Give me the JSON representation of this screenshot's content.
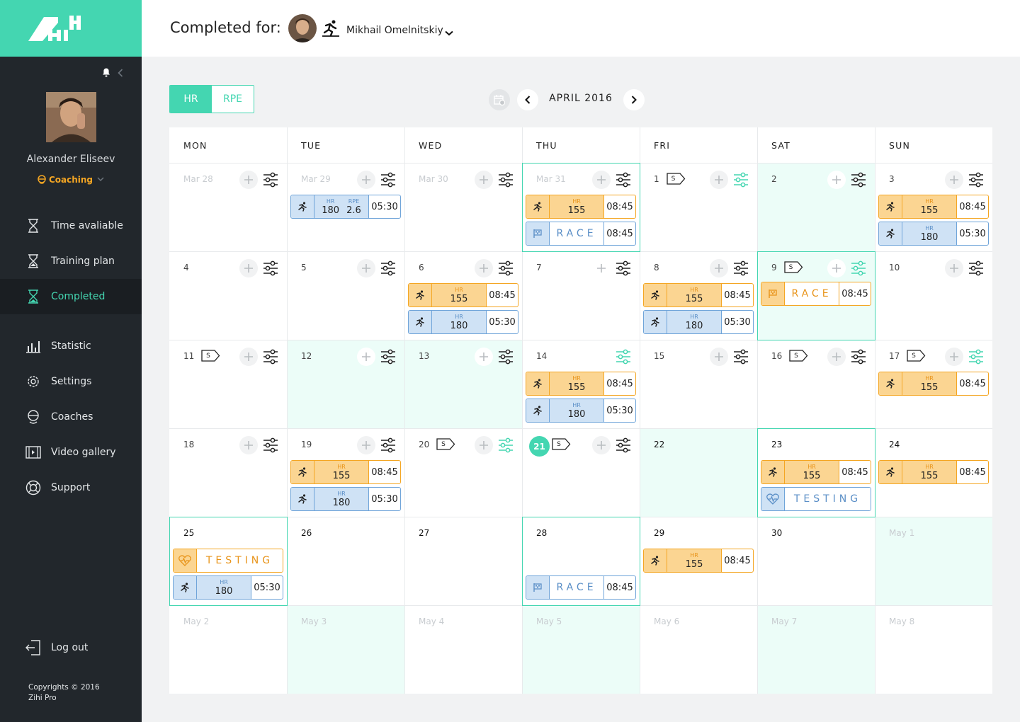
{
  "sidebar": {
    "user_name": "Alexander Eliseev",
    "role_label": "Coaching",
    "nav": [
      {
        "label": "Time avaliable",
        "icon": "hourglass-icon"
      },
      {
        "label": "Training plan",
        "icon": "hourglass-icon"
      },
      {
        "label": "Completed",
        "icon": "hourglass-icon",
        "active": true
      },
      {
        "label": "Statistic",
        "icon": "bar-chart-icon"
      },
      {
        "label": "Settings",
        "icon": "gear-icon"
      },
      {
        "label": "Coaches",
        "icon": "coach-icon"
      },
      {
        "label": "Video gallery",
        "icon": "video-icon"
      },
      {
        "label": "Support",
        "icon": "lifebuoy-icon"
      }
    ],
    "logout_label": "Log out",
    "copyright_line1": "Copyrights © 2016",
    "copyright_line2": "Zihi Pro"
  },
  "header": {
    "title": "Completed for:",
    "athlete_name": "Mikhail Omelnitskiy"
  },
  "toolbar": {
    "toggle": [
      "HR",
      "RPE"
    ],
    "month_label": "APRIL 2016"
  },
  "colors": {
    "accent": "#44d6b1",
    "orange": "#f4a623",
    "blue": "#6fa4d9",
    "sidebar": "#22272c"
  },
  "calendar": {
    "days_of_week": [
      "MON",
      "TUE",
      "WED",
      "THU",
      "FRI",
      "SAT",
      "SUN"
    ],
    "weeks": [
      [
        {
          "label": "Mar 28",
          "out": true,
          "plus": true,
          "settings": "gray"
        },
        {
          "label": "Mar 29",
          "out": true,
          "plus": true,
          "settings": "gray",
          "cards": [
            {
              "color": "blue",
              "kind": "run",
              "metrics": [
                {
                  "l": "HR",
                  "v": "180"
                },
                {
                  "l": "RPE",
                  "v": "2.6"
                }
              ],
              "time": "05:30"
            }
          ]
        },
        {
          "label": "Mar 30",
          "out": true,
          "plus": true,
          "settings": "gray"
        },
        {
          "label": "Mar 31",
          "out": true,
          "plus": true,
          "settings": "gray",
          "selected": true,
          "cards": [
            {
              "color": "orange",
              "kind": "run",
              "metrics": [
                {
                  "l": "HR",
                  "v": "155"
                }
              ],
              "time": "08:45"
            },
            {
              "color": "blue",
              "kind": "race",
              "text": "RACE",
              "time": "08:45"
            }
          ]
        },
        {
          "label": "1",
          "stag": true,
          "plus": true,
          "settings": "green"
        },
        {
          "label": "2",
          "highlight": true,
          "plus": true,
          "plusWhite": true,
          "settings": "gray"
        },
        {
          "label": "3",
          "plus": true,
          "settings": "gray",
          "cards": [
            {
              "color": "orange",
              "kind": "run",
              "metrics": [
                {
                  "l": "HR",
                  "v": "155"
                }
              ],
              "time": "08:45"
            },
            {
              "color": "blue",
              "kind": "run",
              "metrics": [
                {
                  "l": "HR",
                  "v": "180"
                }
              ],
              "time": "05:30"
            }
          ]
        }
      ],
      [
        {
          "label": "4",
          "plus": true,
          "settings": "gray"
        },
        {
          "label": "5",
          "plus": true,
          "settings": "gray"
        },
        {
          "label": "6",
          "plus": true,
          "settings": "gray",
          "cards": [
            {
              "color": "orange",
              "kind": "run",
              "metrics": [
                {
                  "l": "HR",
                  "v": "155"
                }
              ],
              "time": "08:45"
            },
            {
              "color": "blue",
              "kind": "run",
              "metrics": [
                {
                  "l": "HR",
                  "v": "180"
                }
              ],
              "time": "05:30"
            }
          ]
        },
        {
          "label": "7",
          "plus": true,
          "plusBare": true,
          "settings": "gray"
        },
        {
          "label": "8",
          "plus": true,
          "settings": "gray",
          "cards": [
            {
              "color": "orange",
              "kind": "run",
              "metrics": [
                {
                  "l": "HR",
                  "v": "155"
                }
              ],
              "time": "08:45"
            },
            {
              "color": "blue",
              "kind": "run",
              "metrics": [
                {
                  "l": "HR",
                  "v": "180"
                }
              ],
              "time": "05:30"
            }
          ]
        },
        {
          "label": "9",
          "stag": true,
          "plus": true,
          "settings": "green",
          "selected": true,
          "highlight": true,
          "plusWhite": true,
          "cards": [
            {
              "color": "orange",
              "kind": "race",
              "text": "RACE",
              "time": "08:45"
            }
          ]
        },
        {
          "label": "10",
          "plus": true,
          "settings": "gray"
        }
      ],
      [
        {
          "label": "11",
          "stag": true,
          "plus": true,
          "settings": "gray"
        },
        {
          "label": "12",
          "highlight": true,
          "plus": true,
          "plusWhite": true,
          "settings": "gray"
        },
        {
          "label": "13",
          "highlight": true,
          "plus": true,
          "plusWhite": true,
          "settings": "gray"
        },
        {
          "label": "14",
          "settings": "green",
          "cards": [
            {
              "color": "orange",
              "kind": "run",
              "metrics": [
                {
                  "l": "HR",
                  "v": "155"
                }
              ],
              "time": "08:45"
            },
            {
              "color": "blue",
              "kind": "run",
              "metrics": [
                {
                  "l": "HR",
                  "v": "180"
                }
              ],
              "time": "05:30"
            }
          ]
        },
        {
          "label": "15",
          "plus": true,
          "settings": "gray"
        },
        {
          "label": "16",
          "stag": true,
          "plus": true,
          "settings": "gray"
        },
        {
          "label": "17",
          "stag": true,
          "plus": true,
          "settings": "green",
          "cards": [
            {
              "color": "orange",
              "kind": "run",
              "metrics": [
                {
                  "l": "HR",
                  "v": "155"
                }
              ],
              "time": "08:45"
            }
          ]
        }
      ],
      [
        {
          "label": "18",
          "plus": true,
          "settings": "gray"
        },
        {
          "label": "19",
          "plus": true,
          "settings": "gray",
          "cards": [
            {
              "color": "orange",
              "kind": "run",
              "metrics": [
                {
                  "l": "HR",
                  "v": "155"
                }
              ],
              "time": "08:45"
            },
            {
              "color": "blue",
              "kind": "run",
              "metrics": [
                {
                  "l": "HR",
                  "v": "180"
                }
              ],
              "time": "05:30"
            }
          ]
        },
        {
          "label": "20",
          "stag": true,
          "plus": true,
          "settings": "green"
        },
        {
          "label": "21",
          "today": true,
          "stag": true,
          "plus": true,
          "settings": "gray"
        },
        {
          "label": "22",
          "bold": true,
          "highlight": true
        },
        {
          "label": "23",
          "bold": true,
          "selected": true,
          "cards": [
            {
              "color": "orange",
              "kind": "run",
              "metrics": [
                {
                  "l": "HR",
                  "v": "155"
                }
              ],
              "time": "08:45"
            },
            {
              "color": "blue",
              "kind": "test",
              "text": "TESTING"
            }
          ]
        },
        {
          "label": "24",
          "bold": true,
          "cards": [
            {
              "color": "orange",
              "kind": "run",
              "metrics": [
                {
                  "l": "HR",
                  "v": "155"
                }
              ],
              "time": "08:45"
            }
          ]
        }
      ],
      [
        {
          "label": "25",
          "bold": true,
          "selected": true,
          "cards": [
            {
              "color": "orange",
              "kind": "test",
              "text": "TESTING"
            },
            {
              "color": "blue",
              "kind": "run",
              "metrics": [
                {
                  "l": "HR",
                  "v": "180"
                }
              ],
              "time": "05:30"
            }
          ]
        },
        {
          "label": "26",
          "bold": true
        },
        {
          "label": "27",
          "bold": true
        },
        {
          "label": "28",
          "bold": true,
          "selected": true,
          "cards": [
            {
              "gap": true
            },
            {
              "color": "blue",
              "kind": "race",
              "text": "RACE",
              "time": "08:45"
            }
          ]
        },
        {
          "label": "29",
          "bold": true,
          "cards": [
            {
              "color": "orange",
              "kind": "run",
              "metrics": [
                {
                  "l": "HR",
                  "v": "155"
                }
              ],
              "time": "08:45"
            }
          ]
        },
        {
          "label": "30",
          "bold": true
        },
        {
          "label": "May 1",
          "out": true,
          "highlight": true
        }
      ],
      [
        {
          "label": "May 2",
          "out": true
        },
        {
          "label": "May 3",
          "out": true,
          "highlight": true
        },
        {
          "label": "May 4",
          "out": true
        },
        {
          "label": "May 5",
          "out": true,
          "highlight": true
        },
        {
          "label": "May 6",
          "out": true
        },
        {
          "label": "May 7",
          "out": true,
          "highlight": true
        },
        {
          "label": "May 8",
          "out": true
        }
      ]
    ]
  }
}
